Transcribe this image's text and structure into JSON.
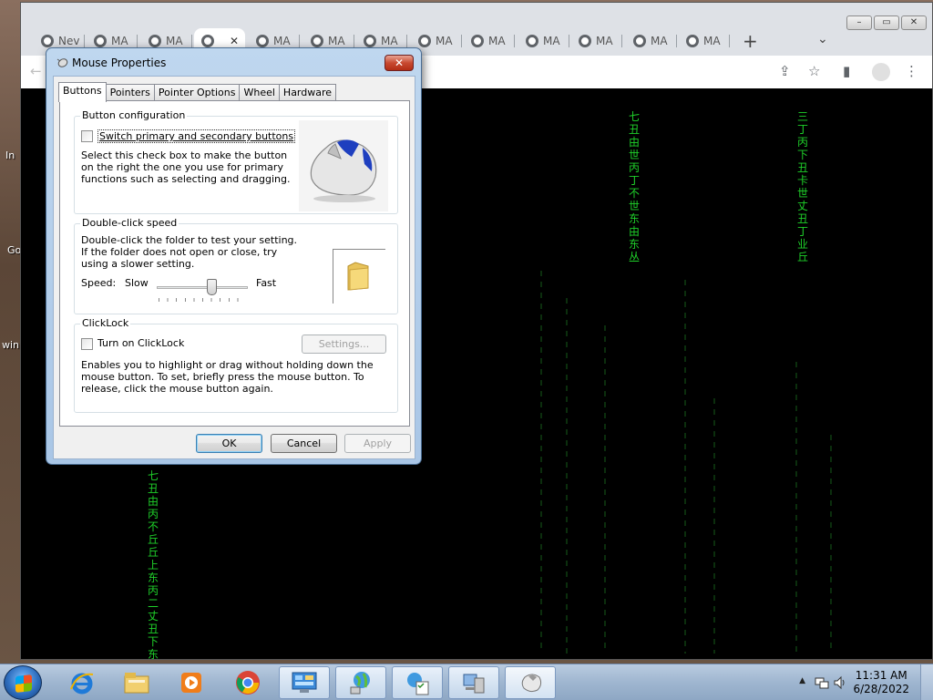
{
  "desktop": {
    "labels": [
      "In",
      "Go",
      "win"
    ]
  },
  "browser": {
    "tabs": [
      {
        "label": "Nev",
        "active": false
      },
      {
        "label": "MA",
        "active": false
      },
      {
        "label": "MA",
        "active": false
      },
      {
        "label": "",
        "active": true
      },
      {
        "label": "MA",
        "active": false
      },
      {
        "label": "MA",
        "active": false
      },
      {
        "label": "MA",
        "active": false
      },
      {
        "label": "MA",
        "active": false
      },
      {
        "label": "MA",
        "active": false
      },
      {
        "label": "MA",
        "active": false
      },
      {
        "label": "MA",
        "active": false
      },
      {
        "label": "MA",
        "active": false
      },
      {
        "label": "MA",
        "active": false
      }
    ],
    "new_tab_label": "+",
    "tab_menu_label": "⌄",
    "matrix_columns": [
      {
        "text": "七丑由世丙丁不世东由东丛"
      },
      {
        "text": "三丁丙下丑卡世丈丑丁业丘"
      },
      {
        "text": "七丑由丙不丘丘上东丙二丈丑下东丈"
      }
    ]
  },
  "dialog": {
    "title": "Mouse Properties",
    "close_glyph": "✕",
    "tabs": [
      "Buttons",
      "Pointers",
      "Pointer Options",
      "Wheel",
      "Hardware"
    ],
    "active_tab": "Buttons",
    "button_configuration": {
      "title": "Button configuration",
      "checkbox_label": "Switch primary and secondary buttons",
      "checked": false,
      "description": "Select this check box to make the button on the right the one you use for primary functions such as selecting and dragging."
    },
    "double_click": {
      "title": "Double-click speed",
      "description": "Double-click the folder to test your setting. If the folder does not open or close, try using a slower setting.",
      "speed_label": "Speed:",
      "slow_label": "Slow",
      "fast_label": "Fast",
      "slider_value": 0.6
    },
    "clicklock": {
      "title": "ClickLock",
      "checkbox_label": "Turn on ClickLock",
      "checked": false,
      "settings_label": "Settings...",
      "description": "Enables you to highlight or drag without holding down the mouse button. To set, briefly press the mouse button. To release, click the mouse button again."
    },
    "buttons": {
      "ok": "OK",
      "cancel": "Cancel",
      "apply": "Apply"
    }
  },
  "taskbar": {
    "time": "11:31 AM",
    "date": "6/28/2022",
    "tray_arrow": "▲"
  }
}
